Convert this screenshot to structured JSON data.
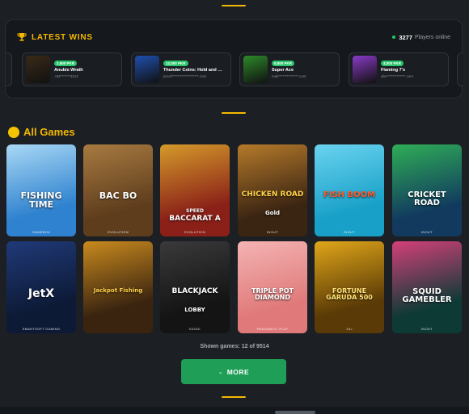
{
  "latest_wins": {
    "title": "LATEST WINS",
    "players_count": "3277",
    "players_label": "Players online",
    "items": [
      {
        "amount": "2,600 PKR",
        "game": "Anubis Wrath",
        "user": "+92*******3212",
        "color": "#3a2a18"
      },
      {
        "amount": "12,000 PKR",
        "game": "Thunder Coins: Hold and …",
        "user": "proof*******************.com",
        "color": "#1f4fb0"
      },
      {
        "amount": "8,800 PKR",
        "game": "Super Ace",
        "user": "mali**************.com",
        "color": "#2e8a2a"
      },
      {
        "amount": "4,000 PKR",
        "game": "Flaming 7's",
        "user": "abe*************.com",
        "color": "#8a3ac8"
      }
    ]
  },
  "all_games": {
    "title": "All Games",
    "tiles": [
      {
        "title": "FISHING TIME",
        "provider": "GAMEBOX",
        "bg": "#2f82cf",
        "bg2": "#a9d8f5",
        "title_color": "#ffffff",
        "size": 11
      },
      {
        "title": "BAC BO",
        "provider": "EVOLUTION",
        "bg": "#5e3d1d",
        "bg2": "#a87a40",
        "title_color": "#ffffff",
        "size": 11
      },
      {
        "title": "BACCARAT A",
        "subtitle": "SPEED",
        "provider": "EVOLUTION",
        "bg": "#8a2018",
        "bg2": "#d49a2a",
        "title_color": "#ffffff",
        "size": 9
      },
      {
        "title": "CHICKEN ROAD",
        "subtitle": "Gold",
        "provider": "INOUT",
        "bg": "#3a2412",
        "bg2": "#b57a2a",
        "title_color": "#ffd34a",
        "size": 9
      },
      {
        "title": "FISH BOOM",
        "provider": "INOUT",
        "bg": "#18a0c8",
        "bg2": "#6ad3ef",
        "title_color": "#ff5a2a",
        "size": 10
      },
      {
        "title": "CRICKET ROAD",
        "provider": "INOUT",
        "bg": "#113a5e",
        "bg2": "#2fae57",
        "title_color": "#ffffff",
        "size": 10
      },
      {
        "title": "JetX",
        "provider": "SMARTSOFT GAMING",
        "bg": "#0d1a36",
        "bg2": "#203a78",
        "title_color": "#ffffff",
        "size": 14
      },
      {
        "title": "Jackpot Fishing",
        "provider": "",
        "bg": "#3a2410",
        "bg2": "#c98a1e",
        "title_color": "#ffd34a",
        "size": 7
      },
      {
        "title": "BLACKJACK",
        "subtitle": "LOBBY",
        "provider": "EZUGI",
        "bg": "#141414",
        "bg2": "#3a3a3a",
        "title_color": "#ffffff",
        "size": 9
      },
      {
        "title": "TRIPLE POT DIAMOND",
        "provider": "PRAGMATIC PLAY",
        "bg": "#e07a7a",
        "bg2": "#f4b3b3",
        "title_color": "#ffffff",
        "size": 8
      },
      {
        "title": "FORTUNE GARUDA 500",
        "provider": "JILI",
        "bg": "#5a3a06",
        "bg2": "#e0a61a",
        "title_color": "#ffe27a",
        "size": 8
      },
      {
        "title": "SQUID GAMEBLER",
        "provider": "INOUT",
        "bg": "#0e3a36",
        "bg2": "#d4407a",
        "title_color": "#ffffff",
        "size": 10
      }
    ]
  },
  "pagination": {
    "shown_text": "Shown games: 12 of 9514",
    "more_label": "MORE"
  }
}
